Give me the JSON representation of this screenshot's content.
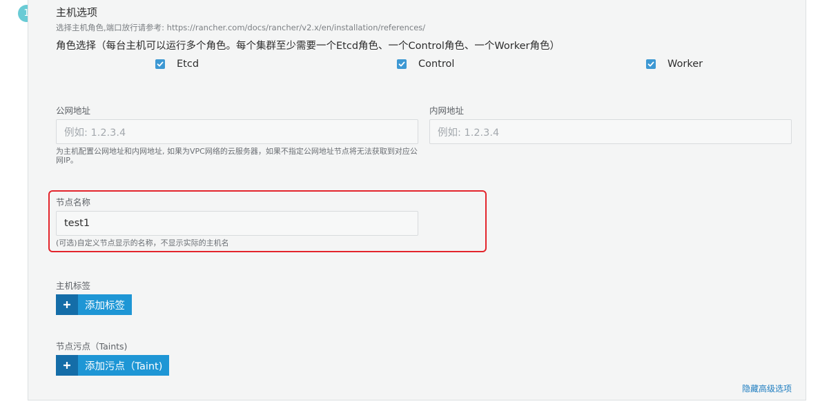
{
  "step": {
    "number": "1"
  },
  "section": {
    "title": "主机选项",
    "subtitle": "选择主机角色,端口放行请参考: https://rancher.com/docs/rancher/v2.x/en/installation/references/"
  },
  "roles": {
    "heading": "角色选择（每台主机可以运行多个角色。每个集群至少需要一个Etcd角色、一个Control角色、一个Worker角色）",
    "items": [
      {
        "label": "Etcd",
        "checked": true
      },
      {
        "label": "Control",
        "checked": true
      },
      {
        "label": "Worker",
        "checked": true
      }
    ]
  },
  "public_address": {
    "label": "公网地址",
    "placeholder": "例如: 1.2.3.4",
    "help": "为主机配置公网地址和内网地址, 如果为VPC网络的云服务器，如果不指定公网地址节点将无法获取到对应公网IP。"
  },
  "internal_address": {
    "label": "内网地址",
    "placeholder": "例如: 1.2.3.4"
  },
  "node_name": {
    "label": "节点名称",
    "value": "test1",
    "help": "(可选)自定义节点显示的名称，不显示实际的主机名"
  },
  "labels": {
    "label": "主机标签",
    "button": "添加标签"
  },
  "taints": {
    "label": "节点污点（Taints)",
    "button": "添加污点（Taint)"
  },
  "advanced": {
    "hide_link": "隐藏高级选项"
  },
  "colors": {
    "accent": "#1e96d5",
    "accent_dark": "#146da8",
    "checkbox": "#3d98d3",
    "step_badge": "#69cbd5",
    "highlight": "#e3242b",
    "panel_bg": "#f4f5f5"
  }
}
